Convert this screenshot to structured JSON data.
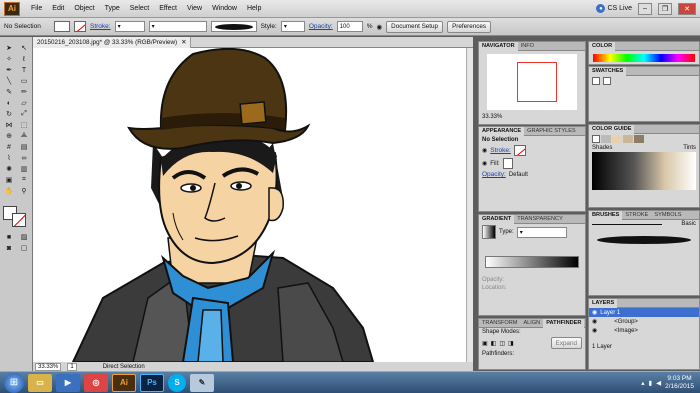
{
  "menubar": {
    "logo": "Ai",
    "items": [
      "File",
      "Edit",
      "Object",
      "Type",
      "Select",
      "Effect",
      "View",
      "Window",
      "Help"
    ],
    "cs_live": "CS Live"
  },
  "control": {
    "selection": "No Selection",
    "stroke_label": "Stroke:",
    "style_label": "Style:",
    "opacity_label": "Opacity:",
    "opacity_value": "100",
    "percent": "%",
    "document_setup": "Document Setup",
    "preferences": "Preferences"
  },
  "document": {
    "tab_title": "20150216_203108.jpg* @ 33.33% (RGB/Preview)",
    "zoom": "33.33%",
    "page": "1",
    "status": "Direct Selection"
  },
  "navigator": {
    "tabs": [
      "NAVIGATOR",
      "INFO"
    ],
    "zoom": "33.33%"
  },
  "appearance": {
    "tabs": [
      "APPEARANCE",
      "GRAPHIC STYLES"
    ],
    "title": "No Selection",
    "stroke": "Stroke:",
    "fill": "Fill:",
    "opacity": "Opacity:",
    "opacity_value": "Default"
  },
  "gradient": {
    "tabs": [
      "GRADIENT",
      "TRANSPARENCY"
    ],
    "type_label": "Type:",
    "opacity_label": "Opacity:",
    "location_label": "Location:"
  },
  "transform": {
    "tabs": [
      "TRANSFORM",
      "ALIGN",
      "PATHFINDER"
    ],
    "shape_modes": "Shape Modes:",
    "expand": "Expand",
    "pathfinders": "Pathfinders:"
  },
  "color": {
    "tabs": [
      "COLOR"
    ]
  },
  "swatches": {
    "tabs": [
      "SWATCHES"
    ]
  },
  "color_guide": {
    "tabs": [
      "COLOR GUIDE"
    ],
    "shades": "Shades",
    "tints": "Tints"
  },
  "brushes": {
    "tabs": [
      "BRUSHES",
      "STROKE",
      "SYMBOLS"
    ],
    "basic": "Basic"
  },
  "layers": {
    "tabs": [
      "LAYERS"
    ],
    "items": [
      "Layer 1",
      "<Group>",
      "<Image>"
    ],
    "footer": "1 Layer"
  },
  "taskbar": {
    "apps": [
      "Ai",
      "Ps",
      "S"
    ],
    "time": "9:03 PM",
    "date": "2/16/2015"
  },
  "colors": {
    "hat": "#4b3512",
    "hat_band": "#9c6a1c",
    "skin": "#f6d3a3",
    "scarf": "#2e8fd4",
    "coat": "#3b3b3b",
    "ai_orange": "#f0a030"
  }
}
